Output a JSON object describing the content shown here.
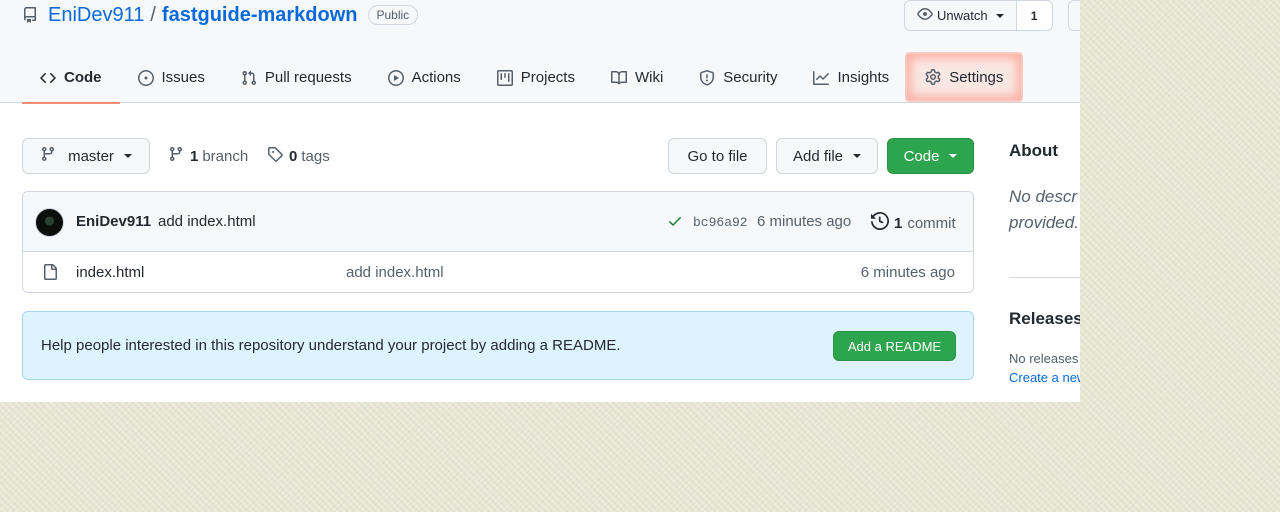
{
  "repo": {
    "owner": "EniDev911",
    "separator": "/",
    "name": "fastguide-markdown",
    "visibility": "Public"
  },
  "watch": {
    "label": "Unwatch",
    "count": "1"
  },
  "tabs": [
    {
      "label": "Code",
      "icon": "code-icon",
      "active": true
    },
    {
      "label": "Issues",
      "icon": "issue-icon"
    },
    {
      "label": "Pull requests",
      "icon": "pull-request-icon"
    },
    {
      "label": "Actions",
      "icon": "play-icon"
    },
    {
      "label": "Projects",
      "icon": "project-icon"
    },
    {
      "label": "Wiki",
      "icon": "book-icon"
    },
    {
      "label": "Security",
      "icon": "shield-icon"
    },
    {
      "label": "Insights",
      "icon": "graph-icon"
    },
    {
      "label": "Settings",
      "icon": "gear-icon",
      "highlighted": true
    }
  ],
  "toolbar": {
    "branch": "master",
    "branch_count": "1",
    "branch_word": "branch",
    "tag_count": "0",
    "tag_word": "tags",
    "go_to_file": "Go to file",
    "add_file": "Add file",
    "code": "Code"
  },
  "commit": {
    "author": "EniDev911",
    "message": "add index.html",
    "sha": "bc96a92",
    "time": "6 minutes ago",
    "count": "1",
    "count_word": "commit"
  },
  "files": [
    {
      "name": "index.html",
      "message": "add index.html",
      "time": "6 minutes ago"
    }
  ],
  "readme_notice": {
    "text": "Help people interested in this repository understand your project by adding a README.",
    "button": "Add a README"
  },
  "sidebar": {
    "about_title": "About",
    "about_desc_line1": "No descr",
    "about_desc_line2": "provided.",
    "releases_title": "Releases",
    "releases_none": "No releases",
    "releases_link": "Create a new"
  },
  "colors": {
    "link": "#0969da",
    "primary_button": "#2da44e",
    "active_tab_underline": "#fd8c73",
    "notice_bg": "#ddf4ff",
    "highlight": "#ff7a5a"
  }
}
